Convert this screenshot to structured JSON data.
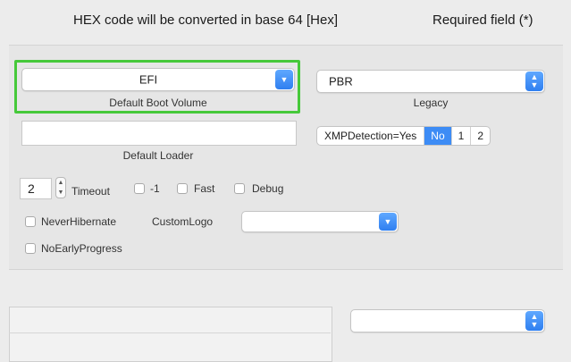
{
  "header": {
    "hex_note": "HEX code will be converted in base 64 [Hex]",
    "required_note": "Required field (*)"
  },
  "boot": {
    "default_volume_value": "EFI",
    "default_volume_label": "Default Boot Volume",
    "legacy_value": "PBR",
    "legacy_label": "Legacy",
    "default_loader_value": "",
    "default_loader_label": "Default Loader"
  },
  "xmp": {
    "label": "XMPDetection=Yes",
    "options": [
      "No",
      "1",
      "2"
    ],
    "selected": "No"
  },
  "timeout": {
    "value": "2",
    "label": "Timeout"
  },
  "checkboxes": {
    "minus_one": "-1",
    "fast": "Fast",
    "debug": "Debug",
    "never_hibernate": "NeverHibernate",
    "no_early_progress": "NoEarlyProgress"
  },
  "custom_logo": {
    "label": "CustomLogo",
    "value": ""
  },
  "lower_popup": {
    "value": ""
  },
  "colors": {
    "accent": "#3d8cf5",
    "highlight_frame": "#46c93a"
  },
  "icons": {
    "popup_arrow": "chevron-updown-icon",
    "stepper": "stepper-icon"
  }
}
